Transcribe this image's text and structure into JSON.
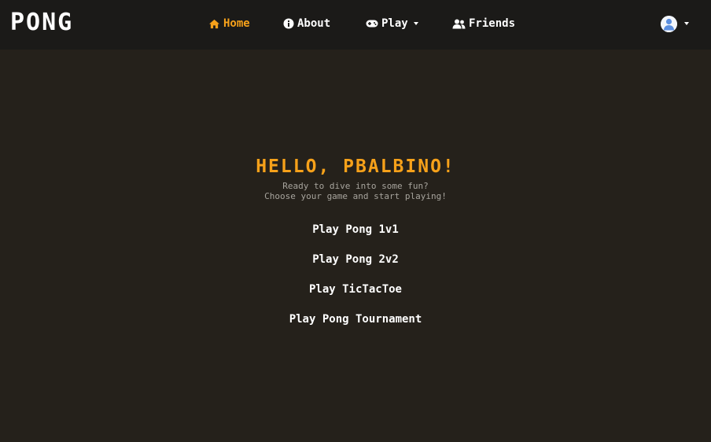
{
  "brand": {
    "logo_text": "PONG"
  },
  "nav": {
    "items": [
      {
        "label": "Home",
        "icon": "home-icon",
        "active": true
      },
      {
        "label": "About",
        "icon": "info-icon"
      },
      {
        "label": "Play",
        "icon": "gamepad-icon",
        "dropdown": true
      },
      {
        "label": "Friends",
        "icon": "users-icon"
      }
    ],
    "active_color": "#f6a11a"
  },
  "user_menu": {
    "icon": "user-avatar-icon",
    "dropdown": true
  },
  "hero": {
    "greeting_prefix": "HELLO,",
    "username": "PBALBINO!",
    "subtitle_line1": "Ready to dive into some fun?",
    "subtitle_line2": "Choose your game and start playing!"
  },
  "games": [
    {
      "label": "Play Pong 1v1"
    },
    {
      "label": "Play Pong 2v2"
    },
    {
      "label": "Play TicTacToe"
    },
    {
      "label": "Play Pong Tournament"
    }
  ],
  "colors": {
    "background": "#25211b",
    "navbar": "#1b1a18",
    "accent": "#f6a11a"
  }
}
